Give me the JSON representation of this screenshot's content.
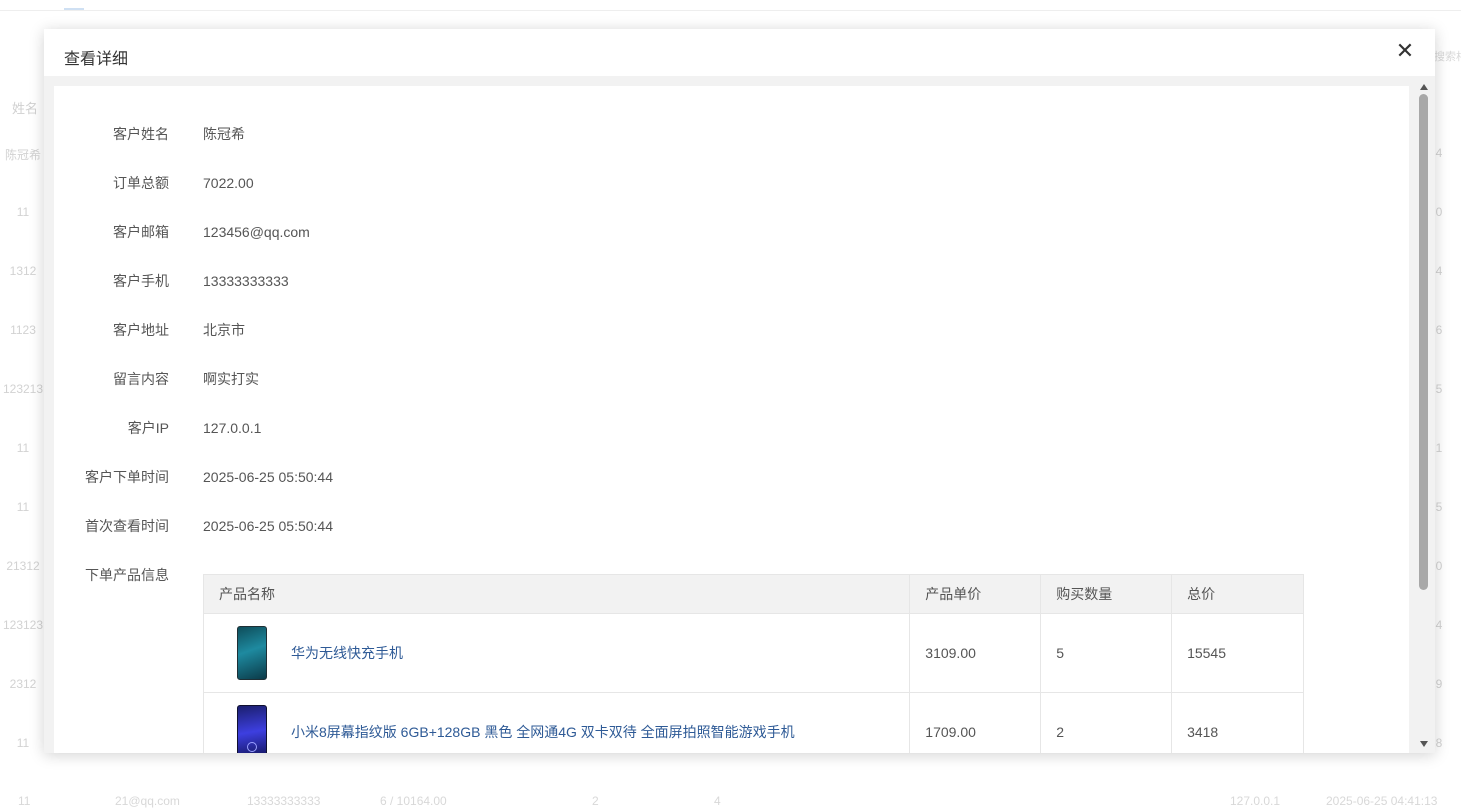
{
  "background": {
    "search_placeholder": "搜索相",
    "header_name": "姓名",
    "left_column": [
      "陈冠希",
      "11",
      "1312",
      "1123",
      "123213",
      "11",
      "11",
      "21312",
      "123123",
      "2312",
      "11"
    ],
    "right_column": [
      "4",
      "0",
      "4",
      "6",
      "5",
      "1",
      "5",
      "0",
      "4",
      "9",
      "8"
    ],
    "bottom_row": [
      "11",
      "21@qq.com",
      "13333333333",
      "6 / 10164.00",
      "2",
      "4",
      "127.0.0.1",
      "2025-06-25 04:41:13"
    ]
  },
  "modal": {
    "title": "查看详细",
    "close_glyph": "✕",
    "fields": [
      {
        "label": "客户姓名",
        "value": "陈冠希"
      },
      {
        "label": "订单总额",
        "value": "7022.00"
      },
      {
        "label": "客户邮箱",
        "value": "123456@qq.com"
      },
      {
        "label": "客户手机",
        "value": "13333333333"
      },
      {
        "label": "客户地址",
        "value": "北京市"
      },
      {
        "label": "留言内容",
        "value": "啊实打实"
      },
      {
        "label": "客户IP",
        "value": "127.0.0.1"
      },
      {
        "label": "客户下单时间",
        "value": "2025-06-25 05:50:44"
      },
      {
        "label": "首次查看时间",
        "value": "2025-06-25 05:50:44"
      }
    ],
    "products_label": "下单产品信息",
    "products_table": {
      "headers": [
        "产品名称",
        "产品单价",
        "购买数量",
        "总价"
      ],
      "rows": [
        {
          "image_icon": "phone-huawei-icon",
          "name": "华为无线快充手机",
          "price": "3109.00",
          "qty": "5",
          "total": "15545"
        },
        {
          "image_icon": "phone-xiaomi-icon",
          "name": "小米8屏幕指纹版 6GB+128GB 黑色 全网通4G 双卡双待 全面屏拍照智能游戏手机",
          "price": "1709.00",
          "qty": "2",
          "total": "3418"
        }
      ]
    }
  },
  "colors": {
    "link": "#2e5a96",
    "header_bg": "#f2f2f2",
    "scrollbar_thumb": "#a8a8a8"
  }
}
